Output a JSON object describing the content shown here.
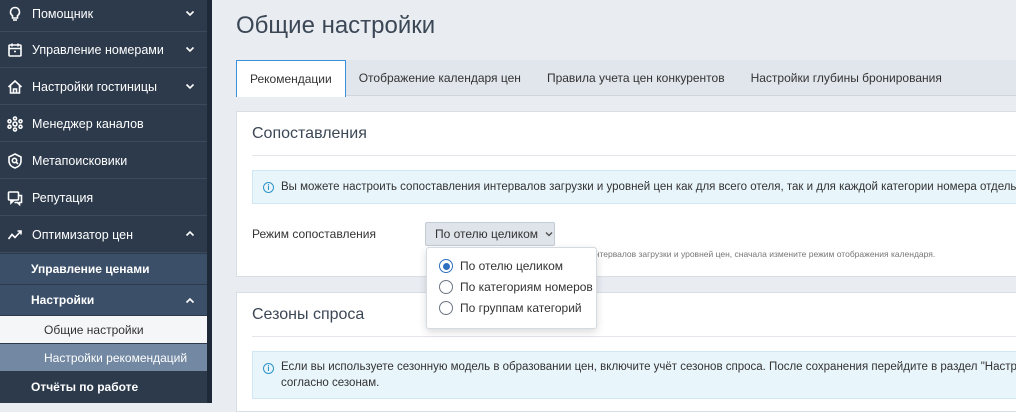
{
  "sidebar": {
    "items": [
      {
        "label": "Помощник",
        "icon": "lightbulb-icon"
      },
      {
        "label": "Управление номерами",
        "icon": "calendar-icon"
      },
      {
        "label": "Настройки гостиницы",
        "icon": "home-icon"
      },
      {
        "label": "Менеджер каналов",
        "icon": "network-icon"
      },
      {
        "label": "Метапоисковики",
        "icon": "search-shield-icon"
      },
      {
        "label": "Репутация",
        "icon": "chat-icon"
      },
      {
        "label": "Оптимизатор цен",
        "icon": "trend-icon"
      }
    ],
    "price_optimizer": {
      "price_management": "Управление ценами",
      "settings": "Настройки",
      "general_settings": "Общие настройки",
      "recommendation_settings": "Настройки рекомендаций",
      "work_reports": "Отчёты по работе"
    }
  },
  "page": {
    "title": "Общие настройки"
  },
  "tabs": [
    {
      "label": "Рекомендации",
      "active": true
    },
    {
      "label": "Отображение календаря цен",
      "active": false
    },
    {
      "label": "Правила учета цен конкурентов",
      "active": false
    },
    {
      "label": "Настройки глубины бронирования",
      "active": false
    }
  ],
  "mapping": {
    "title": "Сопоставления",
    "info": "Вы можете настроить сопоставления интервалов загрузки и уровней цен как для всего отеля, так и для каждой категории номера отдельно.",
    "field_label": "Режим сопоставления",
    "selected_value": "По отелю целиком",
    "hint": "интервалов загрузки и уровней цен, сначала измените режим отображения календаря.",
    "options": [
      {
        "label": "По отелю целиком",
        "checked": true
      },
      {
        "label": "По категориям номеров",
        "checked": false
      },
      {
        "label": "По группам категорий",
        "checked": false
      }
    ]
  },
  "seasons": {
    "title": "Сезоны спроса",
    "info_line1": "Если вы используете сезонную модель в образовании цен, включите учёт сезонов спроса. После сохранения перейдите в раздел \"Настройки",
    "info_line2": "согласно сезонам."
  },
  "colors": {
    "sidebar_bg": "#2c3a4c",
    "accent": "#3b8ed8",
    "active_submenu": "#7288a3",
    "info_bg": "#e8f5fb"
  }
}
